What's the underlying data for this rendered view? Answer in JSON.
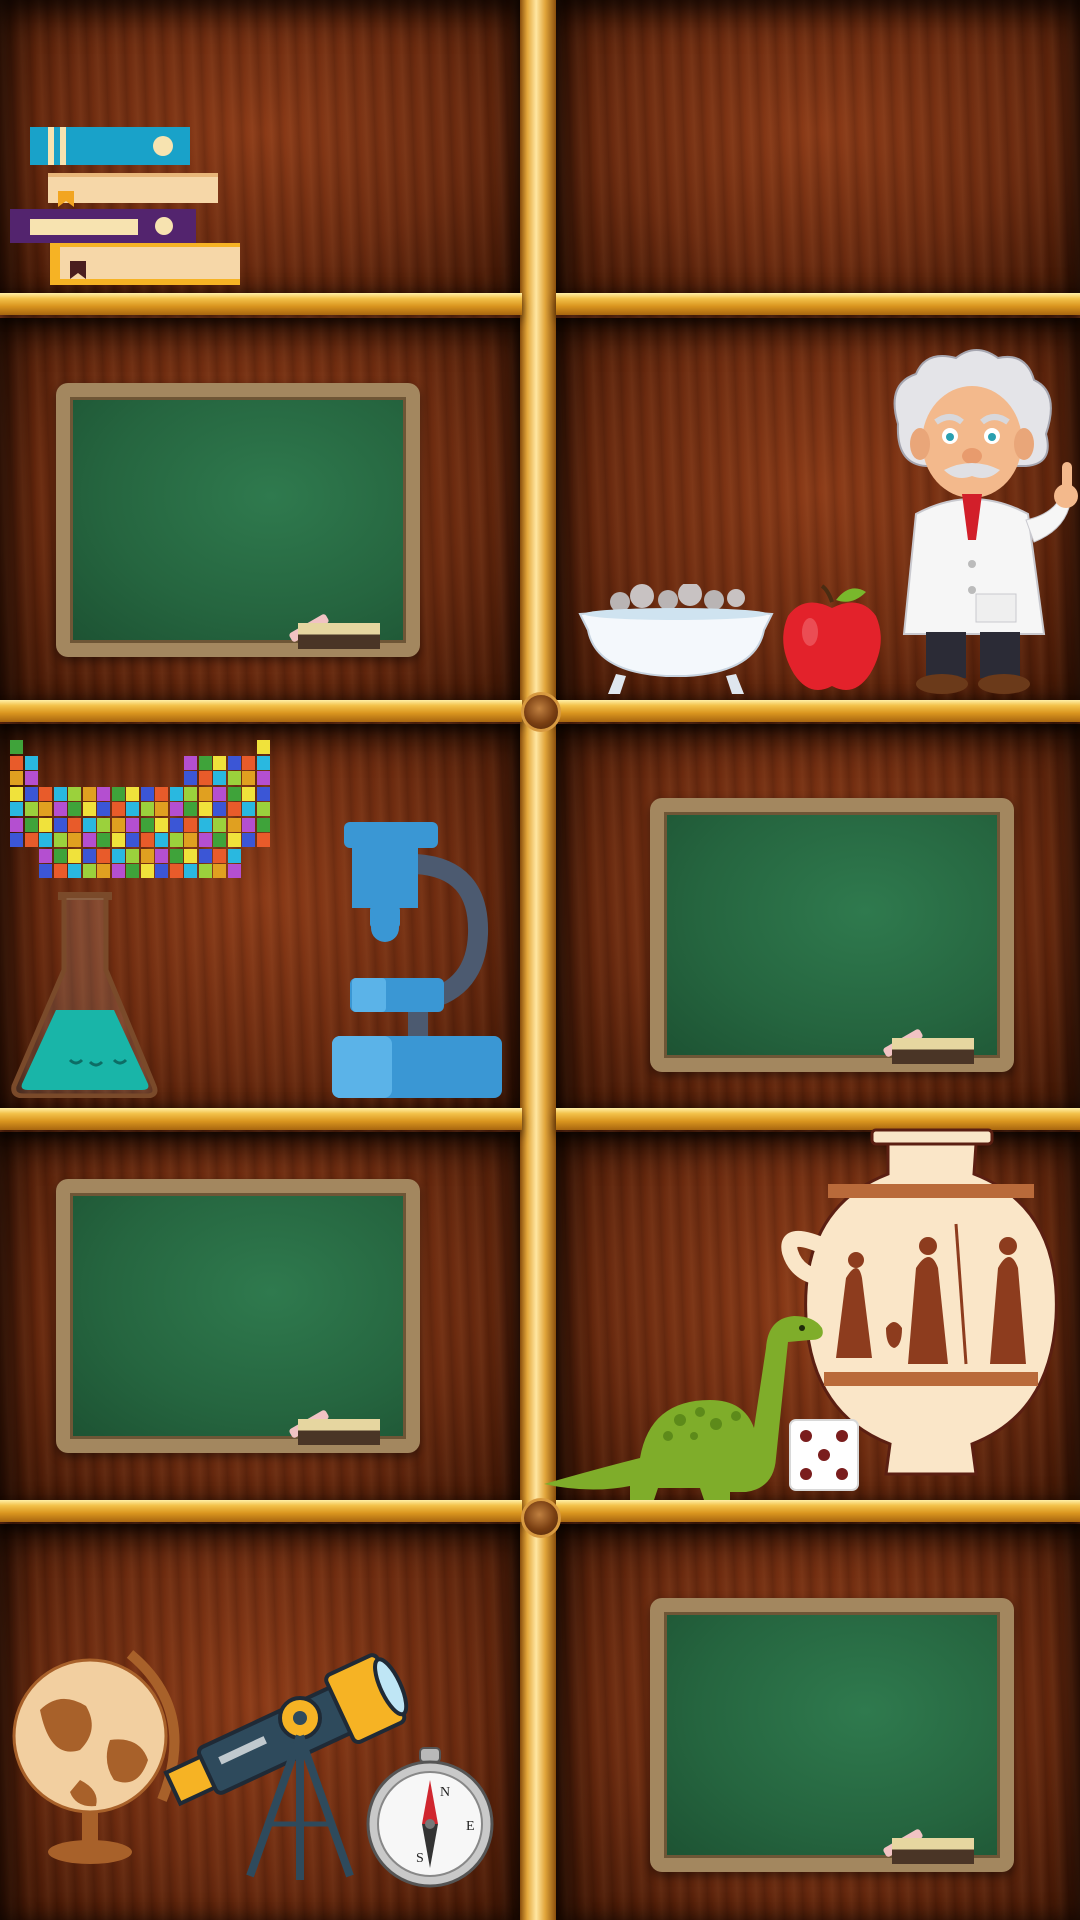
{
  "scene": {
    "theme_colors": {
      "wood": "#6b2a0f",
      "shelf": "#f3c24a",
      "board_frame": "#a3875f",
      "board_green": "#25653f"
    },
    "shelf_items": [
      {
        "shelf": 1,
        "side": "left",
        "icon": "books-stack-icon"
      },
      {
        "shelf": 2,
        "side": "left",
        "icon": "chalkboard-icon"
      },
      {
        "shelf": 2,
        "side": "right",
        "icon": "einstein-cartoon-icon"
      },
      {
        "shelf": 2,
        "side": "right",
        "icon": "bathtub-icon"
      },
      {
        "shelf": 2,
        "side": "right",
        "icon": "apple-icon"
      },
      {
        "shelf": 3,
        "side": "left",
        "icon": "periodic-table-icon"
      },
      {
        "shelf": 3,
        "side": "left",
        "icon": "flask-icon"
      },
      {
        "shelf": 3,
        "side": "left",
        "icon": "microscope-icon"
      },
      {
        "shelf": 3,
        "side": "right",
        "icon": "chalkboard-icon"
      },
      {
        "shelf": 4,
        "side": "left",
        "icon": "chalkboard-icon"
      },
      {
        "shelf": 4,
        "side": "right",
        "icon": "greek-vase-icon"
      },
      {
        "shelf": 4,
        "side": "right",
        "icon": "dinosaur-icon"
      },
      {
        "shelf": 4,
        "side": "right",
        "icon": "dice-icon"
      },
      {
        "shelf": 5,
        "side": "left",
        "icon": "globe-icon"
      },
      {
        "shelf": 5,
        "side": "left",
        "icon": "telescope-icon"
      },
      {
        "shelf": 5,
        "side": "left",
        "icon": "compass-icon"
      },
      {
        "shelf": 5,
        "side": "right",
        "icon": "chalkboard-icon"
      }
    ],
    "compass_letters": {
      "n": "N",
      "e": "E",
      "s": "S"
    }
  }
}
